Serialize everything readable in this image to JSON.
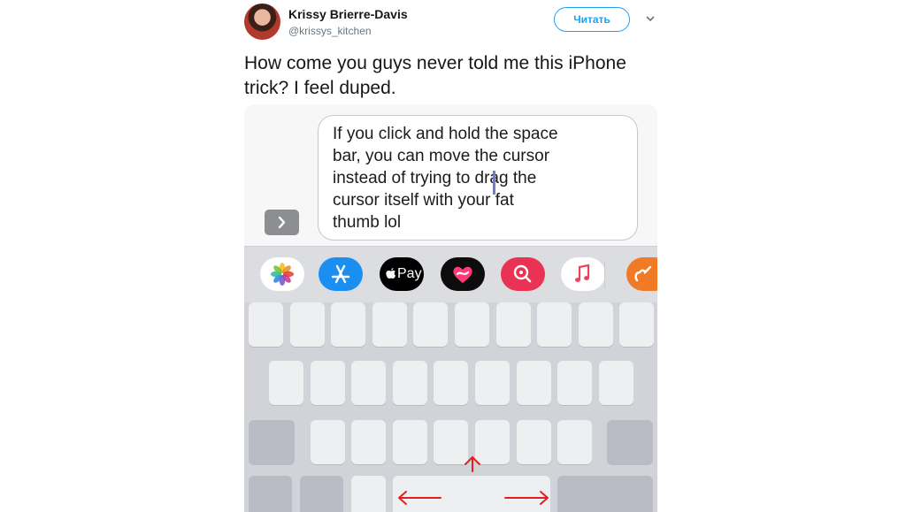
{
  "tweet": {
    "author_name": "Krissy Brierre-Davis",
    "author_handle": "@krissys_kitchen",
    "follow_label": "Читать",
    "text": "How come you guys never told me this iPhone trick? I feel duped."
  },
  "message": {
    "lines": [
      "If you click and hold the space",
      "bar, you can move the cursor",
      "instead of trying to drag the",
      "cursor itself with your fat",
      "thumb lol"
    ]
  },
  "apps": [
    {
      "name": "Photos",
      "icon": "photos-icon"
    },
    {
      "name": "App Store",
      "icon": "app-store-icon"
    },
    {
      "name": "Apple Pay",
      "icon": "apple-pay-icon",
      "label": "Pay"
    },
    {
      "name": "Digital Touch",
      "icon": "digital-touch-icon"
    },
    {
      "name": "Search",
      "icon": "search-images-icon"
    },
    {
      "name": "Music",
      "icon": "music-icon"
    },
    {
      "name": "GarageBand",
      "icon": "garageband-icon"
    }
  ],
  "colors": {
    "accent": "#1da1f2",
    "send": "#1e74e6",
    "arrows": "#e02020"
  }
}
